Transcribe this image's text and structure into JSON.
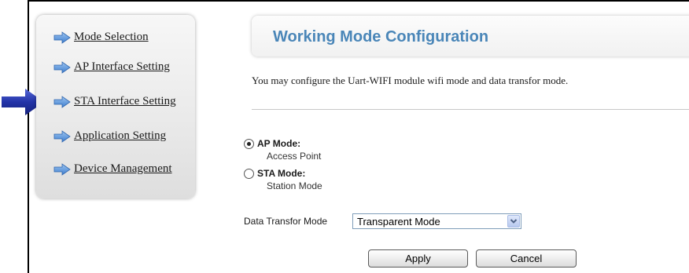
{
  "sidebar": {
    "items": [
      {
        "label": "Mode Selection",
        "icon": "arrow-right-icon"
      },
      {
        "label": "AP Interface Setting",
        "icon": "arrow-right-icon"
      },
      {
        "label": "STA Interface Setting",
        "icon": "arrow-right-icon"
      },
      {
        "label": "Application Setting",
        "icon": "arrow-right-icon"
      },
      {
        "label": "Device Management",
        "icon": "arrow-right-icon"
      }
    ],
    "pointer_icon": "big-pointer-arrow-icon"
  },
  "header": {
    "title": "Working Mode Configuration"
  },
  "main": {
    "description": "You may configure the Uart-WIFI module wifi mode and data transfor mode.",
    "modes": [
      {
        "label": "AP Mode:",
        "sublabel": "Access Point",
        "checked": true
      },
      {
        "label": "STA Mode:",
        "sublabel": "Station Mode",
        "checked": false
      }
    ],
    "data_transfer": {
      "label": "Data Transfor Mode",
      "selected": "Transparent Mode"
    },
    "apply_label": "Apply",
    "cancel_label": "Cancel"
  },
  "colors": {
    "title_color": "#4a86b8",
    "nav_icon_color": "#6aa0dc",
    "pointer_color": "#1e2f9e"
  }
}
